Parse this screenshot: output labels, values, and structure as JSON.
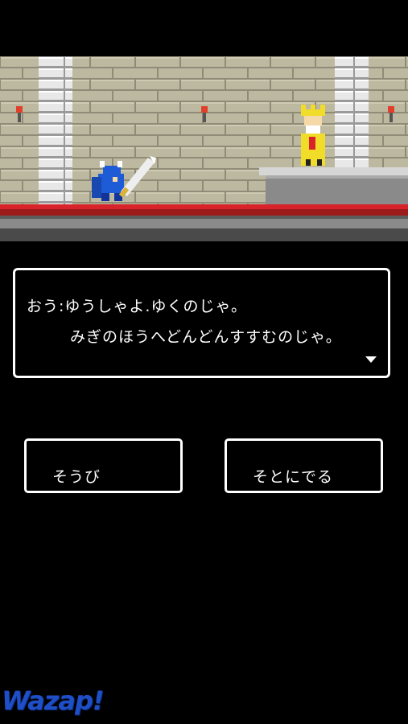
{
  "dialog": {
    "line1": "おう:ゆうしゃよ.ゆくのじゃ。",
    "line2": "みぎのほうへどんどんすすむのじゃ。"
  },
  "buttons": {
    "equip_label": "そうび",
    "exit_label": "そとにでる"
  },
  "logo": {
    "text": "Wazap!"
  },
  "icons": [
    "torch-icon",
    "hero-knight-sprite",
    "king-sprite",
    "advance-arrow-icon"
  ],
  "colors": {
    "background": "#000000",
    "wall": "#b9b59c",
    "floor_accent": "#d8232a",
    "hero": "#1e5bd6",
    "king": "#f2dc2a",
    "logo": "#1e4fc7"
  }
}
